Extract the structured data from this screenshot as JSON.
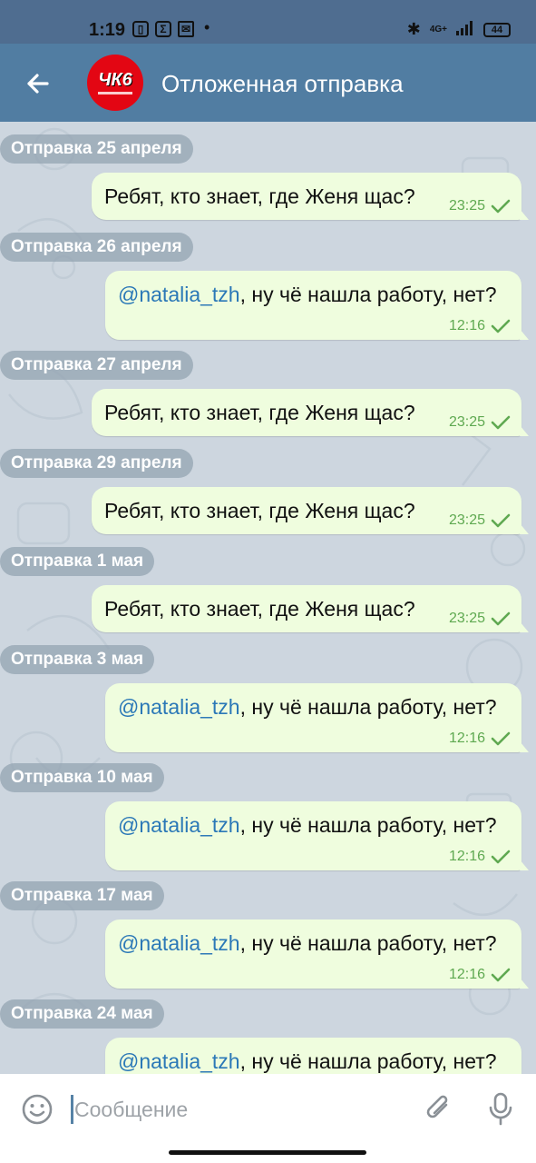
{
  "status_bar": {
    "time": "1:19",
    "notification_icons": [
      "sim-icon",
      "sigma-icon",
      "mail-icon"
    ],
    "signal_text": "4G+",
    "battery": "44"
  },
  "header": {
    "avatar_text": "ЧК6",
    "title": "Отложенная отправка"
  },
  "messages": [
    {
      "date": "Отправка 25 апреля",
      "mention": "",
      "text": "Ребят, кто знает, где Женя щас?",
      "time": "23:25"
    },
    {
      "date": "Отправка 26 апреля",
      "mention": "@natalia_tzh",
      "text": ", ну чё нашла работу, нет?",
      "time": "12:16"
    },
    {
      "date": "Отправка 27 апреля",
      "mention": "",
      "text": "Ребят, кто знает, где Женя щас?",
      "time": "23:25"
    },
    {
      "date": "Отправка 29 апреля",
      "mention": "",
      "text": "Ребят, кто знает, где Женя щас?",
      "time": "23:25"
    },
    {
      "date": "Отправка 1 мая",
      "mention": "",
      "text": "Ребят, кто знает, где Женя щас?",
      "time": "23:25"
    },
    {
      "date": "Отправка 3 мая",
      "mention": "@natalia_tzh",
      "text": ", ну чё нашла работу, нет?",
      "time": "12:16"
    },
    {
      "date": "Отправка 10 мая",
      "mention": "@natalia_tzh",
      "text": ", ну чё нашла работу, нет?",
      "time": "12:16"
    },
    {
      "date": "Отправка 17 мая",
      "mention": "@natalia_tzh",
      "text": ", ну чё нашла работу, нет?",
      "time": "12:16"
    },
    {
      "date": "Отправка 24 мая",
      "mention": "@natalia_tzh",
      "text": ", ну чё нашла работу, нет?",
      "time": ""
    }
  ],
  "composer": {
    "placeholder": "Сообщение"
  },
  "colors": {
    "header": "#517da2",
    "bubble": "#effdde",
    "mention": "#2b78b7",
    "time_check": "#5fa951"
  }
}
